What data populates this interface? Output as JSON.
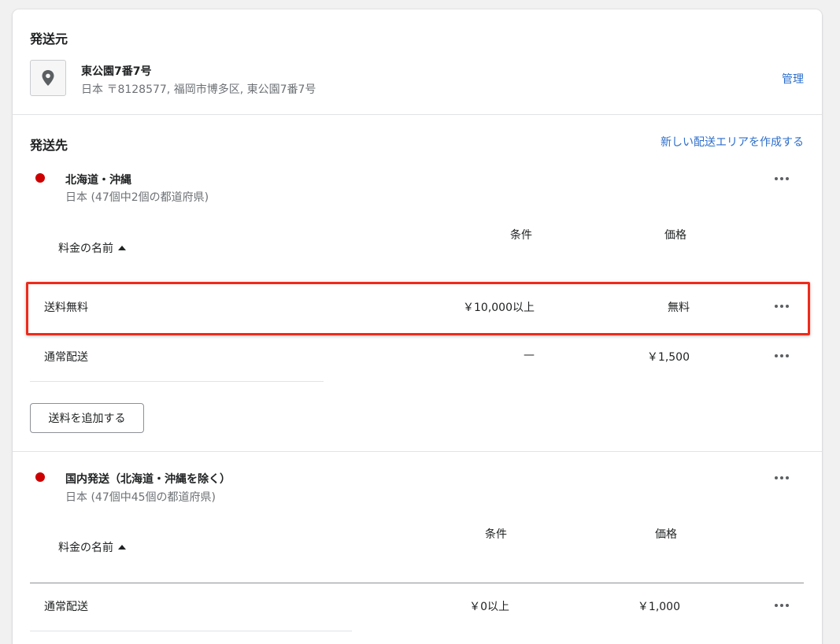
{
  "origin": {
    "title": "発送元",
    "address_name": "東公園7番7号",
    "address_detail": "日本 〒8128577, 福岡市博多区, 東公園7番7号",
    "manage_link": "管理",
    "icon": "location-pin-icon"
  },
  "destination": {
    "title": "発送先",
    "create_zone_link": "新しい配送エリアを作成する",
    "zones": [
      {
        "name": "北海道・沖縄",
        "subtitle": "日本 (47個中2個の都道府県)",
        "columns": {
          "name": "料金の名前",
          "condition": "条件",
          "price": "価格"
        },
        "rates": [
          {
            "name": "送料無料",
            "condition": "￥10,000以上",
            "price": "無料"
          },
          {
            "name": "通常配送",
            "condition": "—",
            "price": "￥1,500"
          }
        ],
        "add_rate_button": "送料を追加する"
      },
      {
        "name": "国内発送（北海道・沖縄を除く）",
        "subtitle": "日本 (47個中45個の都道府県)",
        "columns": {
          "name": "料金の名前",
          "condition": "条件",
          "price": "価格"
        },
        "rates": [
          {
            "name": "通常配送",
            "condition": "￥0以上",
            "price": "￥1,000"
          }
        ]
      }
    ]
  },
  "colors": {
    "zone_dot": "#cc0000",
    "link": "#2c6ecb",
    "highlight": "#ef2a1a"
  }
}
